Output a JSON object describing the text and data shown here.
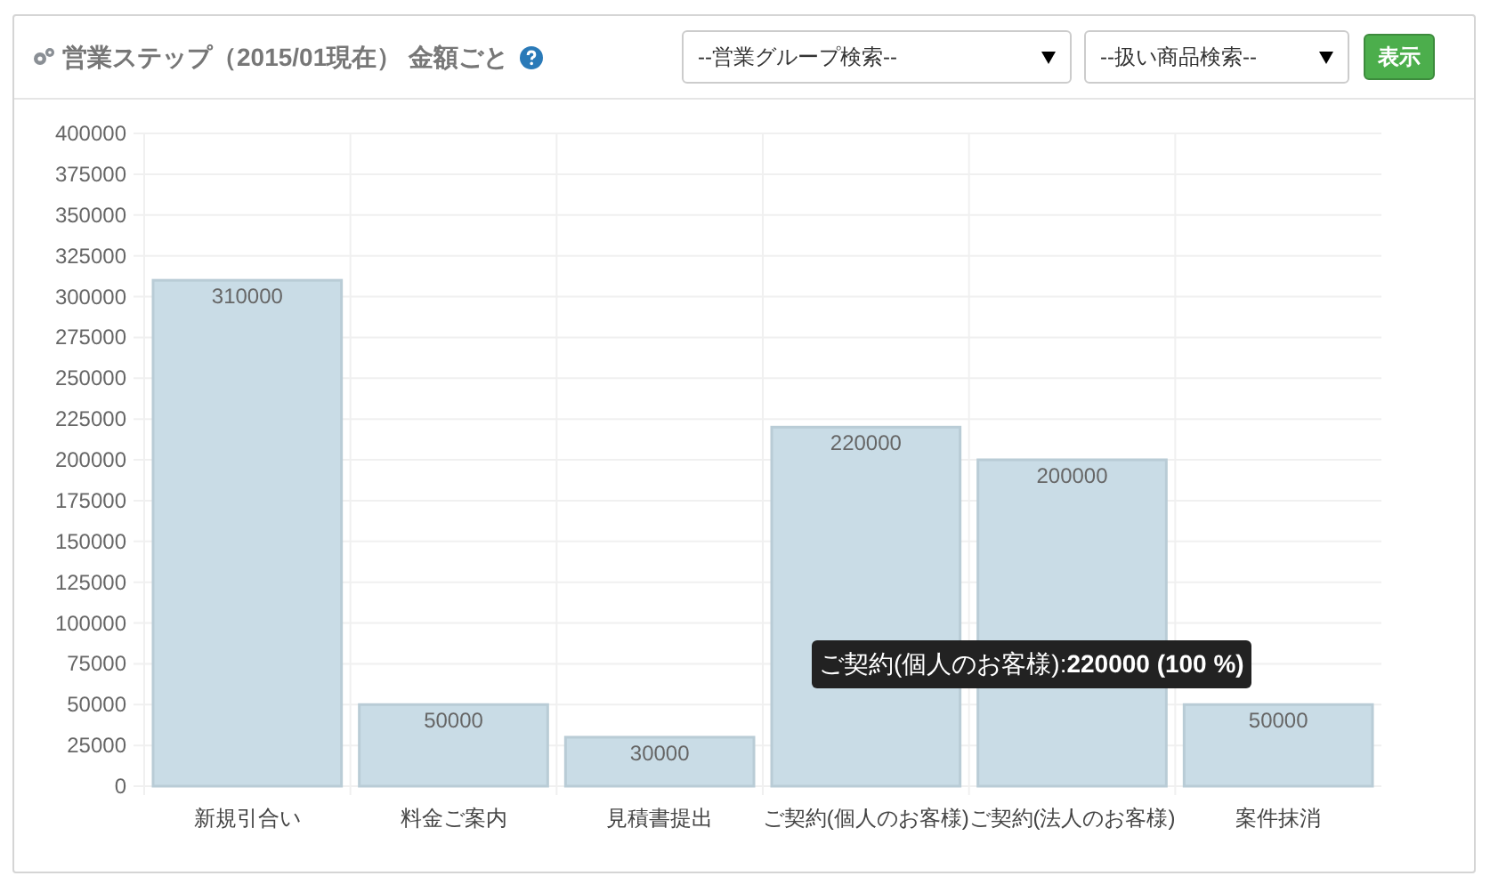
{
  "header": {
    "title": "営業ステップ（2015/01現在） 金額ごと",
    "group_select": {
      "value": "--営業グループ検索--"
    },
    "product_select": {
      "value": "--扱い商品検索--"
    },
    "show_button": "表示"
  },
  "chart": {
    "chart_data": {
      "type": "bar",
      "categories": [
        "新規引合い",
        "料金ご案内",
        "見積書提出",
        "ご契約(個人のお客様)",
        "ご契約(法人のお客様)",
        "案件抹消"
      ],
      "series": [
        {
          "color": "#c9dce6",
          "values": [
            310000,
            50000,
            30000,
            220000,
            200000,
            50000
          ]
        }
      ],
      "ylim": [
        0,
        400000
      ],
      "yticks": [
        0,
        25000,
        50000,
        75000,
        100000,
        125000,
        150000,
        175000,
        200000,
        225000,
        250000,
        275000,
        300000,
        325000,
        350000,
        375000,
        400000
      ],
      "data_labels": true,
      "grid": true
    },
    "tooltip": {
      "text": "ご契約(個人のお客様):**220000 (100 %)**"
    }
  }
}
